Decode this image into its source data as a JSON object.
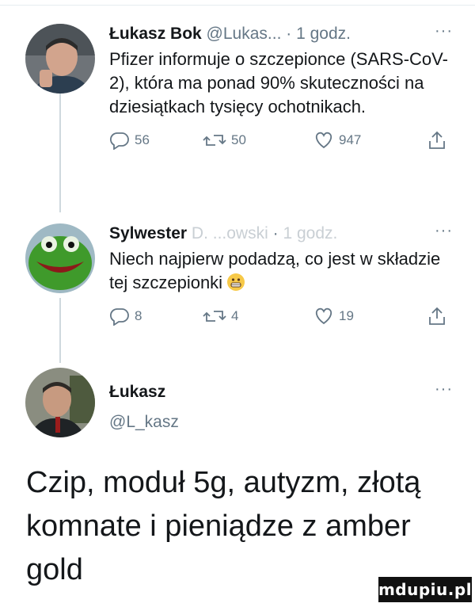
{
  "tweets": [
    {
      "name": "Łukasz Bok",
      "handle": "@Lukas...",
      "dot": "·",
      "time": "1 godz.",
      "more": "···",
      "text": "Pfizer informuje o szczepionce (SARS-CoV-2), która ma ponad 90% skuteczności na dziesiątkach tysięcy ochotnikach.",
      "replies": "56",
      "retweets": "50",
      "likes": "947"
    },
    {
      "name": "Sylwester",
      "handle_redacted": "D. ...owski",
      "dot": "·",
      "time": "1 godz.",
      "more": "···",
      "text": "Niech najpierw podadzą, co jest w składzie tej szczepionki",
      "emoji": "grimacing-face",
      "replies": "8",
      "retweets": "4",
      "likes": "19"
    }
  ],
  "reply_author": {
    "name": "Łukasz",
    "handle": "@L_kasz",
    "more": "···"
  },
  "reply_text": "Czip, moduł 5g, autyzm, złotą komnate i pieniądze z amber gold",
  "watermark": "mdupiu.pl",
  "colors": {
    "text": "#14171a",
    "muted": "#657786",
    "thread_line": "#cfd9de"
  }
}
